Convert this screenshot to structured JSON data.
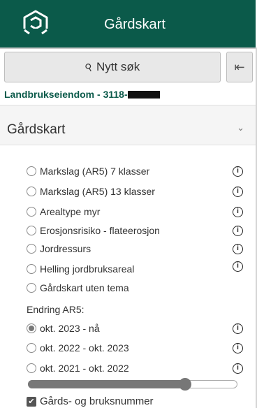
{
  "header": {
    "title": "Gårdskart"
  },
  "search": {
    "label": "Nytt søk",
    "icon": "search-icon"
  },
  "collapse": {
    "icon": "collapse-left-icon",
    "glyph": "⇤"
  },
  "property": {
    "label": "Landbrukseiendom - 3118-"
  },
  "section": {
    "title": "Gårdskart",
    "chevron": "⌄"
  },
  "themes": [
    {
      "label": "Markslag (AR5) 7 klasser",
      "checked": false,
      "info": true
    },
    {
      "label": "Markslag (AR5) 13 klasser",
      "checked": false,
      "info": true
    },
    {
      "label": "Arealtype myr",
      "checked": false,
      "info": true
    },
    {
      "label": "Erosjonsrisiko - flateerosjon",
      "checked": false,
      "info": true
    },
    {
      "label": "Jordressurs",
      "checked": false,
      "info": true
    },
    {
      "label": "Helling jordbruksareal",
      "checked": false,
      "info": true
    },
    {
      "label": "Gårdskart uten tema",
      "checked": false,
      "info": false
    }
  ],
  "change": {
    "heading": "Endring AR5:",
    "options": [
      {
        "label": "okt. 2023 - nå",
        "checked": true,
        "info": true
      },
      {
        "label": "okt. 2022 - okt. 2023",
        "checked": false,
        "info": true
      },
      {
        "label": "okt. 2021 - okt. 2022",
        "checked": false,
        "info": true
      }
    ]
  },
  "opacity_slider": {
    "value_fraction": 0.75
  },
  "checkbox": {
    "label": "Gårds- og bruksnummer",
    "checked": true
  },
  "colors": {
    "brand": "#0b5a4a",
    "header_text": "#ffffff"
  }
}
